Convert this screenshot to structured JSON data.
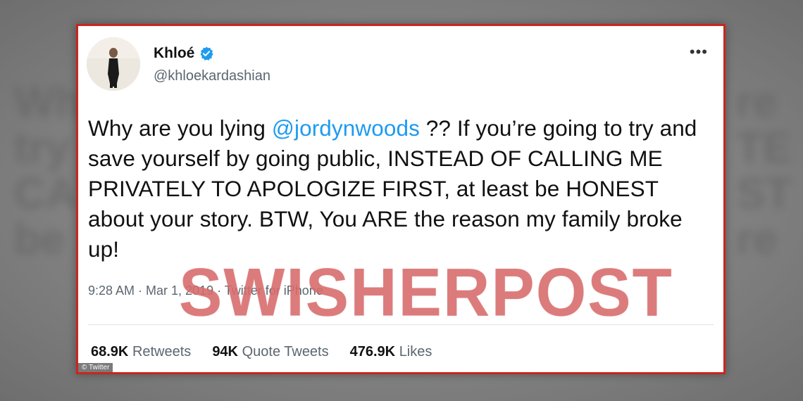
{
  "tweet": {
    "display_name": "Khloé",
    "handle": "@khloekardashian",
    "text_before": "Why are you lying ",
    "mention": "@jordynwoods",
    "text_after": " ?? If you’re going to try and save yourself by going public, INSTEAD OF CALLING ME PRIVATELY TO APOLOGIZE FIRST, at least be HONEST about your story. BTW, You ARE the reason my family broke up!",
    "timestamp": "9:28 AM · Mar 1, 2019 · Twitter for iPhone",
    "more_icon": "•••",
    "stats": {
      "retweets_count": "68.9K",
      "retweets_label": "Retweets",
      "quotes_count": "94K",
      "quotes_label": "Quote Tweets",
      "likes_count": "476.9K",
      "likes_label": "Likes"
    }
  },
  "credit": "© Twitter",
  "watermark": "SWISHERPOST",
  "colors": {
    "border": "#c8261e",
    "mention": "#1d9bf0",
    "verified": "#1d9bf0",
    "watermark": "#da7070"
  },
  "icons": {
    "verified": "verified-badge-icon",
    "more": "more-options-icon"
  }
}
